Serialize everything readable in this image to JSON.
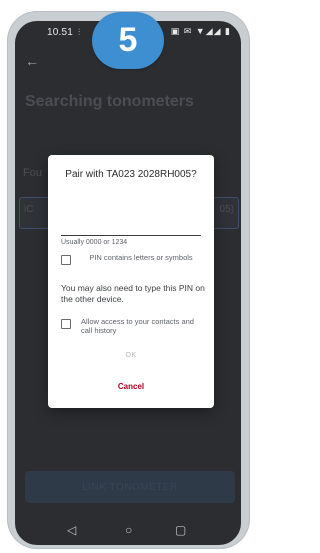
{
  "status": {
    "time": "10.51",
    "small_indicator": "⫶",
    "icons": "▣ ✉ ▼◢◢ ▮"
  },
  "step_badge": "5",
  "page": {
    "back_icon": "arrow-left-icon",
    "title": "Searching tonometers",
    "found_label": "Fou",
    "found_row_left": "iC",
    "found_row_right": "05)",
    "bottom_button": "LINK TONOMETER"
  },
  "dialog": {
    "title": "Pair with TA023 2028RH005?",
    "pin_value": "",
    "pin_hint": "Usually 0000 or 1234",
    "checkbox_pin_letters_label": "PIN contains letters or symbols",
    "info_text": "You may also need to type this PIN on the other device.",
    "checkbox_contacts_label": "Allow access to your contacts and call history",
    "ok_label": "OK",
    "cancel_label": "Cancel"
  },
  "navbar": {
    "back_glyph": "◁",
    "home_glyph": "○",
    "recent_glyph": "▢"
  },
  "colors": {
    "badge": "#3d8fd1",
    "cancel": "#b00020"
  }
}
